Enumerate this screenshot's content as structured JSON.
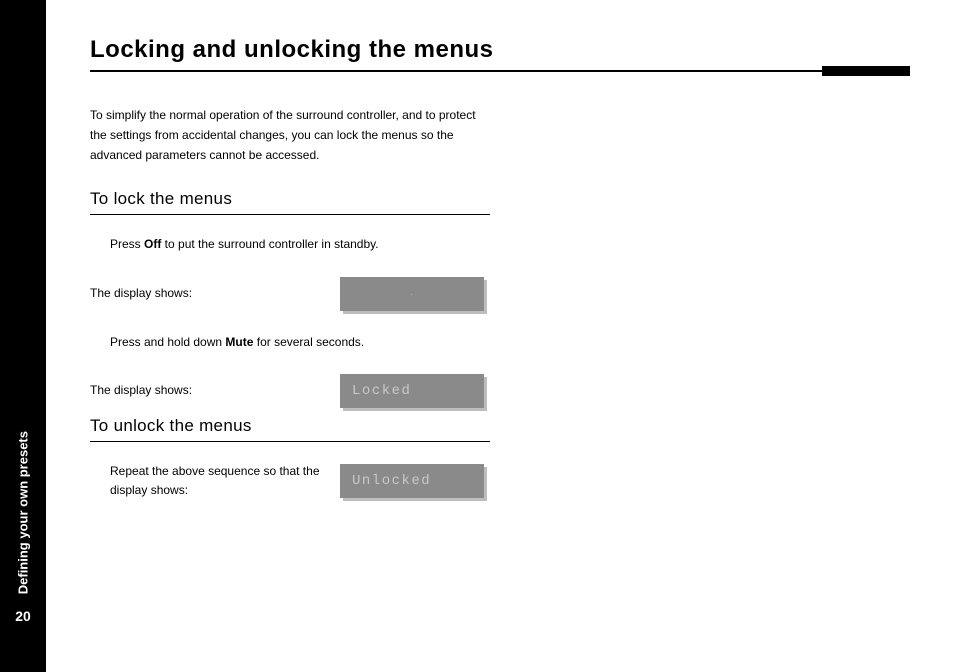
{
  "sidebar": {
    "chapter_label": "Defining your own presets",
    "page_number": "20"
  },
  "title": "Locking and unlocking the menus",
  "intro": "To simplify the normal operation of the surround controller, and to protect the settings from accidental changes, you can lock the menus so the advanced parameters cannot be accessed.",
  "section_lock": {
    "heading": "To lock the menus",
    "step1_pre": "Press ",
    "step1_bold": "Off",
    "step1_post": " to put the surround controller in standby.",
    "display1_label": "The display shows:",
    "lcd1": ".",
    "step2_pre": "Press and hold down ",
    "step2_bold": "Mute",
    "step2_post": " for several seconds.",
    "display2_label": "The display shows:",
    "lcd2": "Locked"
  },
  "section_unlock": {
    "heading": "To unlock the menus",
    "step_pre": "Repeat the above sequence so that the display shows:",
    "lcd": "Unlocked"
  }
}
